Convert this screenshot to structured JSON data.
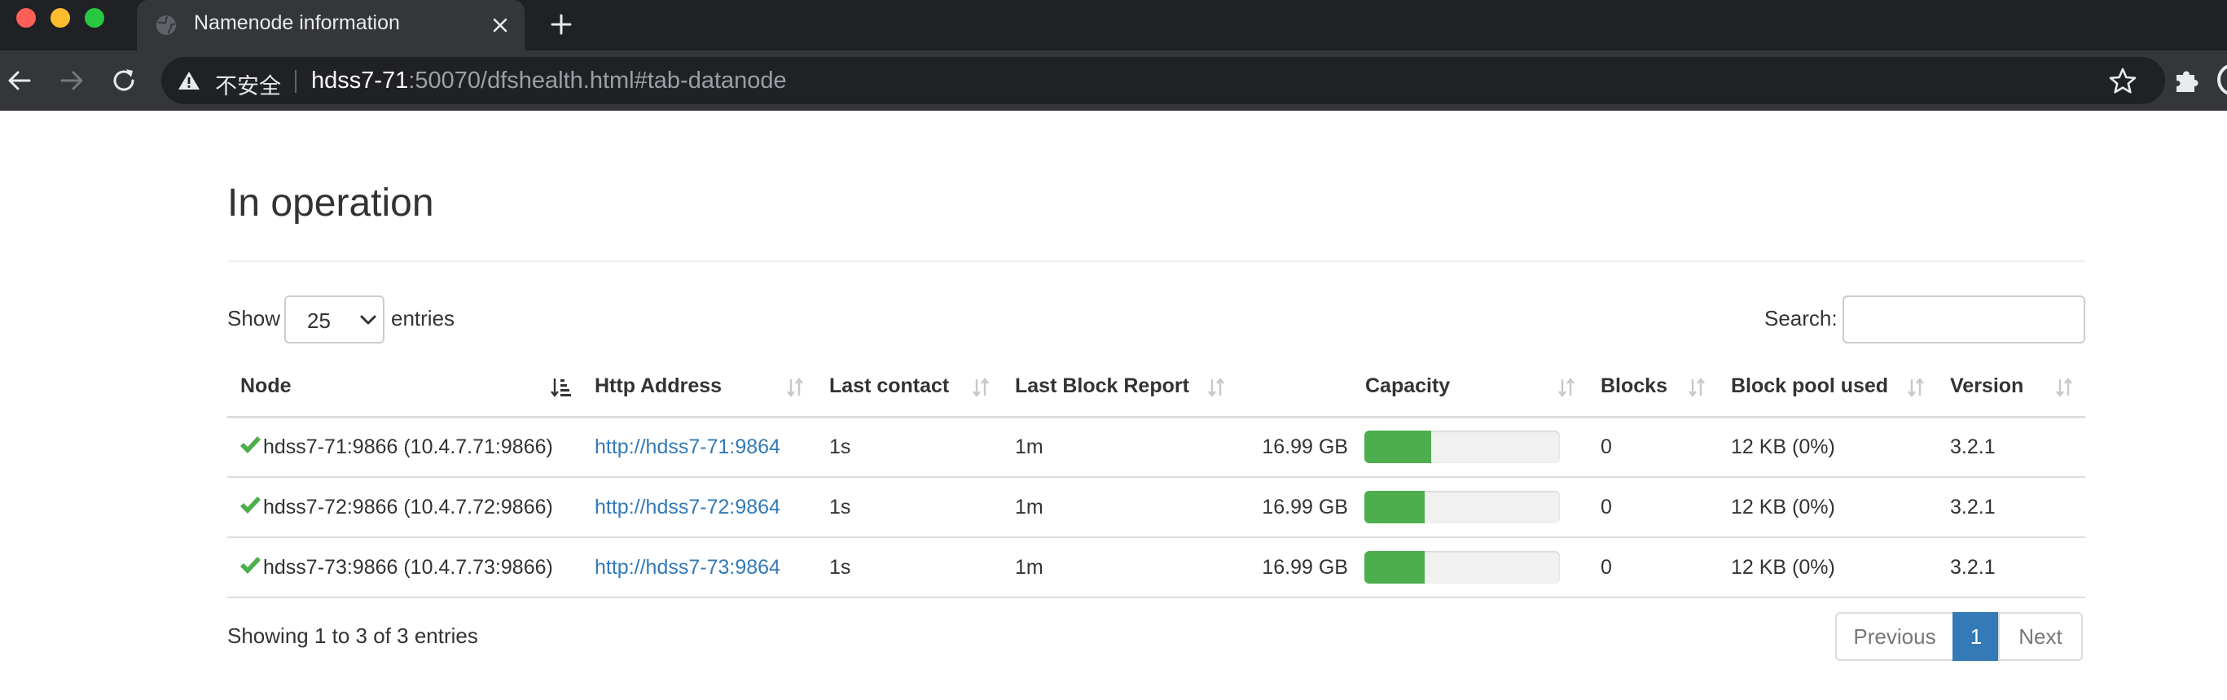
{
  "browser": {
    "tab_title": "Namenode information",
    "security_label": "不安全",
    "url_host": "hdss7-71",
    "url_rest": ":50070/dfshealth.html#tab-datanode"
  },
  "page": {
    "title": "In operation"
  },
  "controls": {
    "show_label": "Show",
    "page_length": "25",
    "entries_label": "entries",
    "search_label": "Search:",
    "search_value": ""
  },
  "table": {
    "headers": [
      "Node",
      "Http Address",
      "Last contact",
      "Last Block Report",
      "Capacity",
      "Blocks",
      "Block pool used",
      "Version"
    ],
    "rows": [
      {
        "node": "hdss7-71:9866 (10.4.7.71:9866)",
        "http": "http://hdss7-71:9864",
        "last_contact": "1s",
        "last_block_report": "1m",
        "capacity": "16.99 GB",
        "capacity_used_pct": 34,
        "blocks": "0",
        "block_pool_used": "12 KB (0%)",
        "version": "3.2.1"
      },
      {
        "node": "hdss7-72:9866 (10.4.7.72:9866)",
        "http": "http://hdss7-72:9864",
        "last_contact": "1s",
        "last_block_report": "1m",
        "capacity": "16.99 GB",
        "capacity_used_pct": 31,
        "blocks": "0",
        "block_pool_used": "12 KB (0%)",
        "version": "3.2.1"
      },
      {
        "node": "hdss7-73:9866 (10.4.7.73:9866)",
        "http": "http://hdss7-73:9864",
        "last_contact": "1s",
        "last_block_report": "1m",
        "capacity": "16.99 GB",
        "capacity_used_pct": 31,
        "blocks": "0",
        "block_pool_used": "12 KB (0%)",
        "version": "3.2.1"
      }
    ]
  },
  "footer": {
    "info": "Showing 1 to 3 of 3 entries",
    "prev_label": "Previous",
    "current_page": "1",
    "next_label": "Next"
  },
  "colors": {
    "link": "#337ab7",
    "status_ok": "#4cae4c",
    "pager_active": "#337ab7"
  },
  "icons": {
    "status": "check-icon",
    "sort": "sort-icon"
  }
}
